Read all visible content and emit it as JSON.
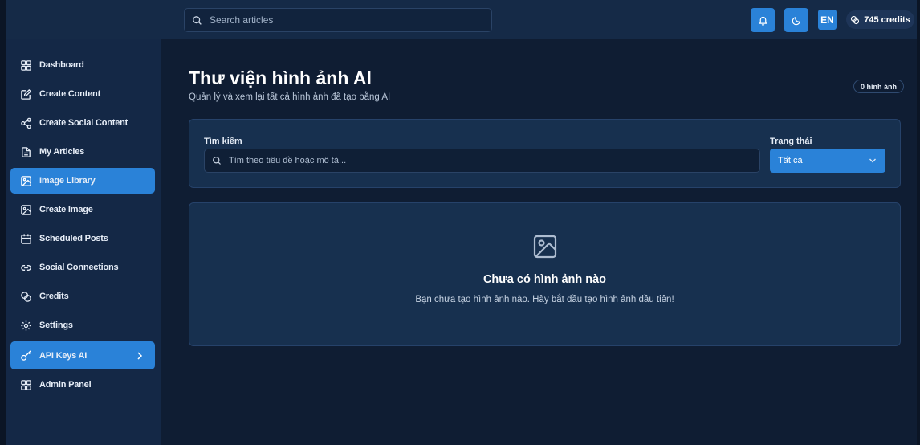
{
  "topbar": {
    "search_placeholder": "Search articles",
    "language": "EN",
    "credits": "745 credits"
  },
  "sidebar": {
    "items": [
      {
        "label": "Dashboard",
        "icon": "dashboard-icon",
        "active": false
      },
      {
        "label": "Create Content",
        "icon": "edit-icon",
        "active": false
      },
      {
        "label": "Create Social Content",
        "icon": "share-icon",
        "active": false
      },
      {
        "label": "My Articles",
        "icon": "document-icon",
        "active": false
      },
      {
        "label": "Image Library",
        "icon": "image-icon",
        "active": true
      },
      {
        "label": "Create Image",
        "icon": "image-icon",
        "active": false
      },
      {
        "label": "Scheduled Posts",
        "icon": "calendar-icon",
        "active": false
      },
      {
        "label": "Social Connections",
        "icon": "link-icon",
        "active": false
      },
      {
        "label": "Credits",
        "icon": "coins-icon",
        "active": false
      },
      {
        "label": "Settings",
        "icon": "gear-icon",
        "active": false
      },
      {
        "label": "API Keys AI",
        "icon": "key-icon",
        "active": true
      },
      {
        "label": "Admin Panel",
        "icon": "dashboard-icon",
        "active": false
      }
    ]
  },
  "main": {
    "title": "Thư viện hình ảnh AI",
    "subtitle": "Quản lý và xem lại tất cả hình ảnh đã tạo bằng AI",
    "count_badge": "0 hình ảnh",
    "filter": {
      "search_label": "Tìm kiếm",
      "search_placeholder": "Tìm theo tiêu đề hoặc mô tả...",
      "status_label": "Trạng thái",
      "status_value": "Tất cả"
    },
    "empty": {
      "title": "Chưa có hình ảnh nào",
      "description": "Bạn chưa tạo hình ảnh nào. Hãy bắt đầu tạo hình ảnh đầu tiên!"
    }
  },
  "colors": {
    "accent": "#2a82d8",
    "background": "#0f1d33",
    "sidebar": "#142846",
    "card": "#17304f"
  }
}
